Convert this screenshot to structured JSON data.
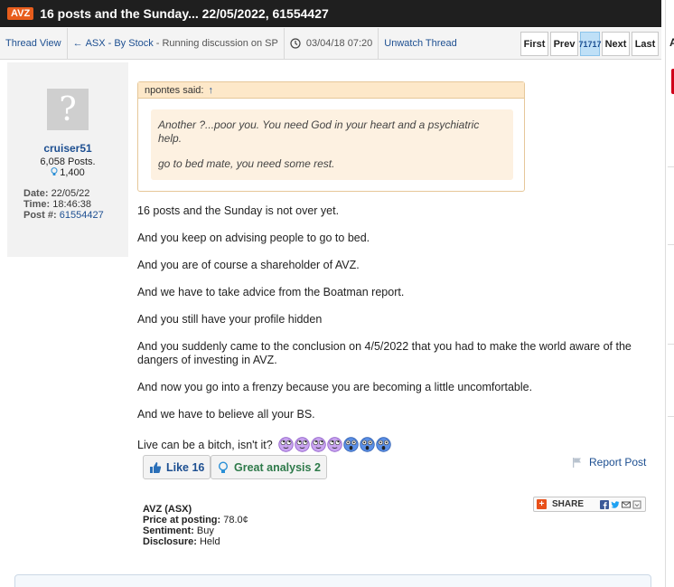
{
  "thread": {
    "ticker": "AVZ",
    "title": "16 posts and the Sunday... 22/05/2022, 61554427"
  },
  "nav": {
    "thread_view": "Thread View",
    "back_arrow": "←",
    "forum": "ASX - By Stock",
    "separator": "-",
    "discussion": "Running discussion on SP",
    "timestamp": "03/04/18 07:20",
    "unwatch": "Unwatch Thread"
  },
  "pager": {
    "first": "First",
    "prev": "Prev",
    "current": "71717",
    "next": "Next",
    "last": "Last"
  },
  "right_panel": {
    "letter": "A"
  },
  "user": {
    "avatar_glyph": "?",
    "name": "cruiser51",
    "posts": "6,058 Posts.",
    "likes": "1,400",
    "date_label": "Date:",
    "date": "22/05/22",
    "time_label": "Time:",
    "time": "18:46:38",
    "post_label": "Post #:",
    "post_number": "61554427"
  },
  "quote": {
    "author": "npontes said:",
    "arrow": "↑",
    "line1": "Another ?...poor you. You need God in your heart and a psychiatric",
    "line2": "help.",
    "line3": "go to bed mate, you need some rest."
  },
  "post": {
    "lines": [
      "16 posts and the Sunday is not over yet.",
      "And you keep on advising people to go to bed.",
      "And you are of course a shareholder of AVZ.",
      "And we have to take advice from the Boatman report.",
      "And you still have your profile hidden",
      "And you suddenly came to the conclusion on 4/5/2022 that you had to make the world aware of the",
      "dangers of investing in AVZ.",
      "And now you go into a frenzy because you are becoming a little uncomfortable.",
      "And we have to believe all your BS.",
      "Live can be a bitch, isn't it?"
    ],
    "emojis": [
      "eye-roll-emoji",
      "eye-roll-emoji",
      "eye-roll-emoji",
      "eye-roll-emoji",
      "shocked-emoji",
      "shocked-emoji",
      "shocked-emoji"
    ]
  },
  "actions": {
    "like_label": "Like 16",
    "great_label": "Great analysis 2",
    "report_label": "Report Post"
  },
  "stock": {
    "code": "AVZ (ASX)",
    "price_label": "Price at posting:",
    "price": "78.0¢",
    "sentiment_label": "Sentiment:",
    "sentiment": "Buy",
    "disclosure_label": "Disclosure:",
    "disclosure": "Held"
  },
  "share": {
    "label": "SHARE",
    "plus": "+"
  },
  "colors": {
    "accent_blue": "#1d4f91",
    "ticker_orange": "#e85d1c",
    "quote_bg": "#fdf1e1",
    "title_bar": "#1f1f1f"
  }
}
